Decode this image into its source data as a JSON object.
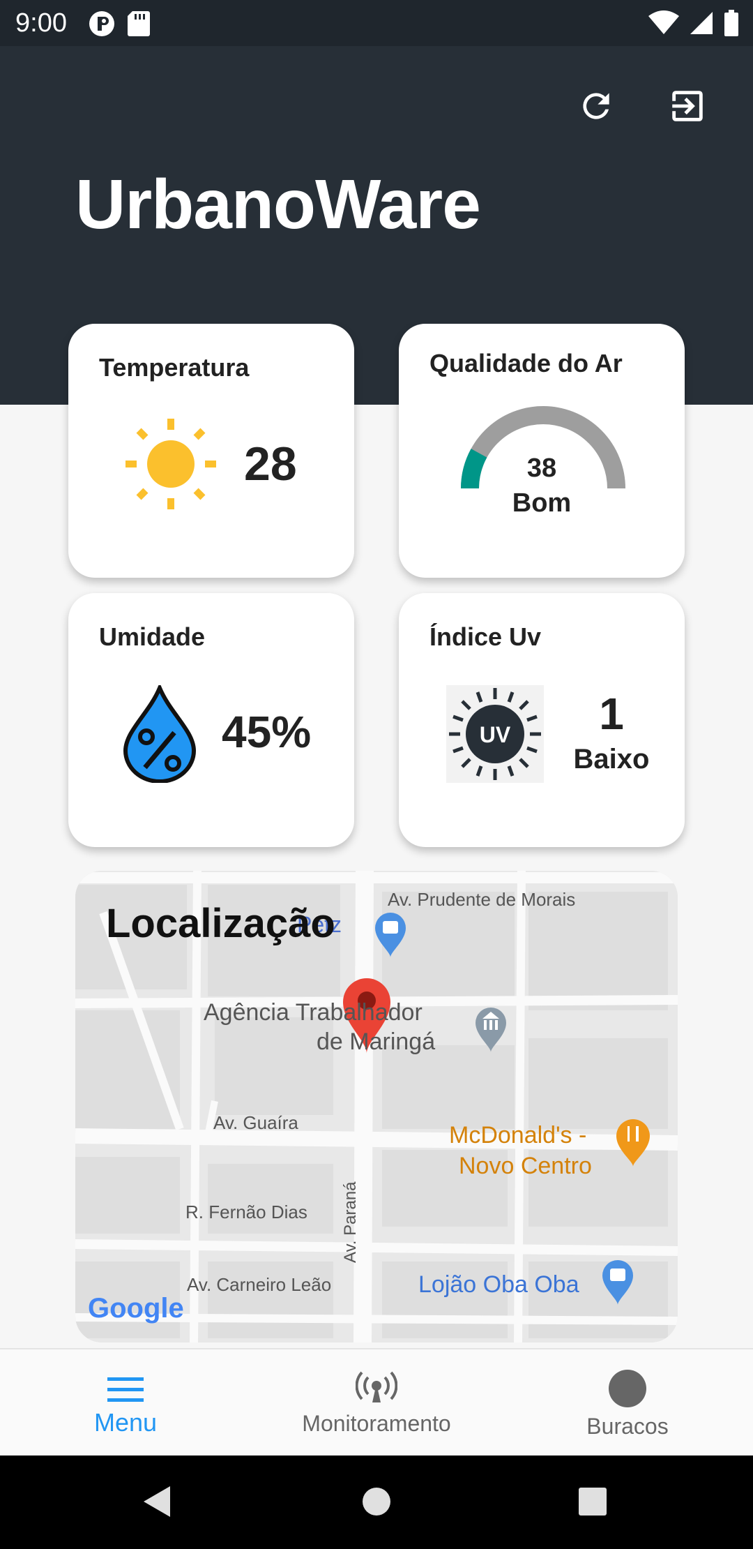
{
  "status_bar": {
    "time": "9:00"
  },
  "header": {
    "title": "UrbanoWare"
  },
  "cards": {
    "temperature": {
      "title": "Temperatura",
      "value": "28"
    },
    "air_quality": {
      "title": "Qualidade do Ar",
      "value": "38",
      "label": "Bom",
      "level_fraction": 0.16
    },
    "humidity": {
      "title": "Umidade",
      "value": "45%"
    },
    "uv": {
      "title": "Índice Uv",
      "value": "1",
      "label": "Baixo",
      "icon_text": "UV"
    }
  },
  "map": {
    "title": "Localização",
    "labels": {
      "prudente": "Av. Prudente de Morais",
      "petz": "Petz",
      "agencia1": "Agência Trabalhador",
      "agencia2": "de Maringá",
      "guaira": "Av. Guaíra",
      "mcd1": "McDonald's -",
      "mcd2": "Novo Centro",
      "fernao": "R. Fernão Dias",
      "parana": "Av. Paraná",
      "carneiro": "Av. Carneiro Leão",
      "lojao": "Lojão Oba Oba",
      "google": "Google"
    }
  },
  "bottom_nav": [
    {
      "label": "Menu",
      "icon": "menu-icon"
    },
    {
      "label": "Monitoramento",
      "icon": "antenna-icon"
    },
    {
      "label": "Buracos",
      "icon": "circle-icon"
    }
  ],
  "colors": {
    "header_bg": "#272f37",
    "accent_blue": "#2196f3",
    "sun_yellow": "#fbc02d",
    "gauge_teal": "#009688",
    "gauge_gray": "#9e9e9e"
  }
}
